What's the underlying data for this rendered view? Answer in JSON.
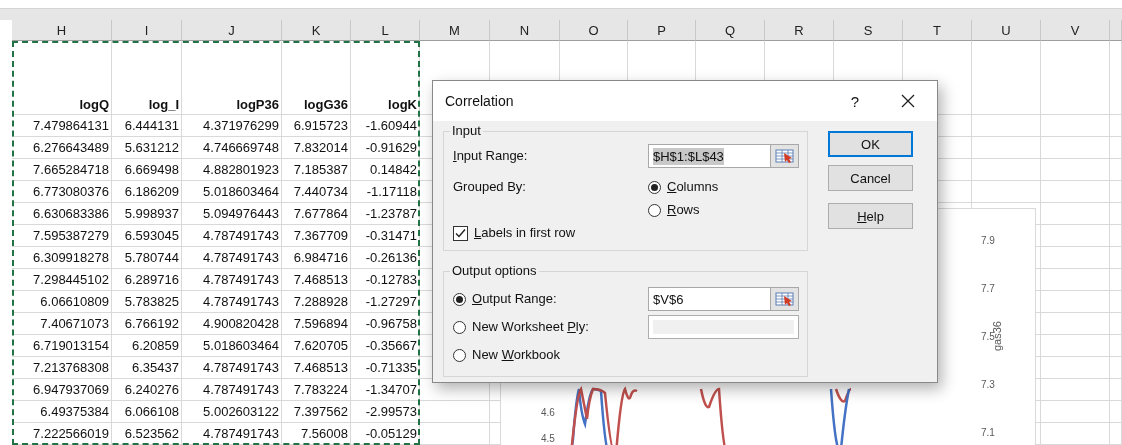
{
  "sheet": {
    "columns": [
      "H",
      "I",
      "J",
      "K",
      "L",
      "M",
      "N",
      "O",
      "P",
      "Q",
      "R",
      "S",
      "T",
      "U",
      "V"
    ],
    "header_row": [
      "logQ",
      "log_I",
      "logP36",
      "logG36",
      "logK"
    ],
    "rows": [
      [
        "7.479864131",
        "6.444131",
        "4.371976299",
        "6.915723",
        "-1.60944"
      ],
      [
        "6.276643489",
        "5.631212",
        "4.746669748",
        "7.832014",
        "-0.91629"
      ],
      [
        "7.665284718",
        "6.669498",
        "4.882801923",
        "7.185387",
        "0.14842"
      ],
      [
        "6.773080376",
        "6.186209",
        "5.018603464",
        "7.440734",
        "-1.17118"
      ],
      [
        "6.630683386",
        "5.998937",
        "5.094976443",
        "7.677864",
        "-1.23787"
      ],
      [
        "7.595387279",
        "6.593045",
        "4.787491743",
        "7.367709",
        "-0.31471"
      ],
      [
        "6.309918278",
        "5.780744",
        "4.787491743",
        "6.984716",
        "-0.26136"
      ],
      [
        "7.298445102",
        "6.289716",
        "4.787491743",
        "7.468513",
        "-0.12783"
      ],
      [
        "6.06610809",
        "5.783825",
        "4.787491743",
        "7.288928",
        "-1.27297"
      ],
      [
        "7.40671073",
        "6.766192",
        "4.900820428",
        "7.596894",
        "-0.96758"
      ],
      [
        "6.719013154",
        "6.20859",
        "5.018603464",
        "7.620705",
        "-0.35667"
      ],
      [
        "7.213768308",
        "6.35437",
        "4.787491743",
        "7.468513",
        "-0.71335"
      ],
      [
        "6.947937069",
        "6.240276",
        "4.787491743",
        "7.783224",
        "-1.34707"
      ],
      [
        "6.49375384",
        "6.066108",
        "5.002603122",
        "7.397562",
        "-2.99573"
      ],
      [
        "7.222566019",
        "6.523562",
        "4.787491743",
        "7.56008",
        "-0.05129"
      ]
    ]
  },
  "chart": {
    "left_axis_ticks": [
      "4.6",
      "4.5"
    ],
    "right_axis_ticks": [
      "7.9",
      "7.7",
      "7.5",
      "7.3",
      "7.1"
    ],
    "right_axis_title": "gas36"
  },
  "dialog": {
    "title": "Correlation",
    "help_glyph": "?",
    "input_group": {
      "legend": "Input",
      "input_range": {
        "label": {
          "key": "I",
          "post": "nput Range:"
        },
        "value": "$H$1:$L$43",
        "text_selected": true
      },
      "grouped_by": {
        "label": "Grouped By:",
        "options": [
          {
            "label": {
              "key": "C",
              "post": "olumns"
            },
            "selected": true
          },
          {
            "label": {
              "key": "R",
              "post": "ows"
            },
            "selected": false
          }
        ]
      },
      "labels_in_first_row": {
        "label": {
          "key": "L",
          "post": "abels in first row"
        },
        "checked": true
      }
    },
    "output_group": {
      "legend": "Output options",
      "options": [
        {
          "label": {
            "key": "O",
            "post": "utput Range:"
          },
          "selected": true,
          "field": {
            "value": "$V$6",
            "picker": true,
            "disabled": false
          }
        },
        {
          "label": {
            "pre": "New Worksheet ",
            "key": "P",
            "post": "ly:"
          },
          "selected": false,
          "field": {
            "picker": false,
            "disabled": true
          }
        },
        {
          "label": {
            "pre": "New ",
            "key": "W",
            "post": "orkbook"
          },
          "selected": false
        }
      ]
    },
    "buttons": [
      {
        "label": {
          "post": "OK"
        },
        "default": true
      },
      {
        "label": {
          "post": "Cancel"
        },
        "default": false
      },
      {
        "label": {
          "key": "H",
          "post": "elp"
        },
        "default": false
      }
    ]
  }
}
